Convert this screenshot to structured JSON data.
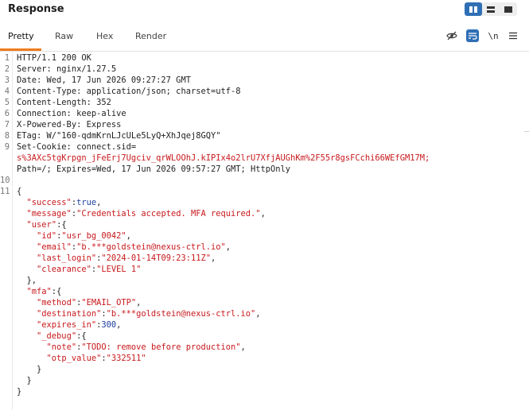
{
  "panel": {
    "title": "Response",
    "view_modes": [
      "split-view-icon",
      "horizontal-view-icon",
      "single-view-icon"
    ]
  },
  "tabs": {
    "pretty": "Pretty",
    "raw": "Raw",
    "hex": "Hex",
    "render": "Render"
  },
  "toolbar": {
    "newline_label": "\\n",
    "icons": [
      "hide-icon",
      "wrap-icon",
      "newline-icon",
      "menu-icon"
    ]
  },
  "colors": {
    "accent_tab": "#f07b1d",
    "accent_button": "#2f6fb5",
    "string": "#c8191d",
    "number": "#1d3fa0"
  },
  "response": {
    "lines": [
      {
        "n": "1",
        "text": "HTTP/1.1 200 OK"
      },
      {
        "n": "2",
        "text": "Server: nginx/1.27.5"
      },
      {
        "n": "3",
        "text": "Date: Wed, 17 Jun 2026 09:27:27 GMT"
      },
      {
        "n": "4",
        "text": "Content-Type: application/json; charset=utf-8"
      },
      {
        "n": "5",
        "text": "Content-Length: 352"
      },
      {
        "n": "6",
        "text": "Connection: keep-alive"
      },
      {
        "n": "7",
        "text": "X-Powered-By: Express"
      },
      {
        "n": "8",
        "text": "ETag: W/\"160-qdmKrnLJcULe5LyQ+XhJqej8GQY\""
      },
      {
        "n": "9",
        "text": "Set-Cookie: connect.sid="
      },
      {
        "n": "",
        "text": "s%3AXc5tgKrpgn_jFeErj7Ugciv_qrWLOOhJ.kIPIx4o2lrU7XfjAUGhKm%2F55r8gsFCchi66WEfGM17M;"
      },
      {
        "n": "",
        "text": "Path=/; Expires=Wed, 17 Jun 2026 09:57:27 GMT; HttpOnly"
      },
      {
        "n": "10",
        "text": ""
      },
      {
        "n": "11",
        "text": "{"
      },
      {
        "n": "",
        "text": "  \"success\":true,"
      },
      {
        "n": "",
        "text": "  \"message\":\"Credentials accepted. MFA required.\","
      },
      {
        "n": "",
        "text": "  \"user\":{"
      },
      {
        "n": "",
        "text": "    \"id\":\"usr_bg_0042\","
      },
      {
        "n": "",
        "text": "    \"email\":\"b.***goldstein@nexus-ctrl.io\","
      },
      {
        "n": "",
        "text": "    \"last_login\":\"2024-01-14T09:23:11Z\","
      },
      {
        "n": "",
        "text": "    \"clearance\":\"LEVEL 1\""
      },
      {
        "n": "",
        "text": "  },"
      },
      {
        "n": "",
        "text": "  \"mfa\":{"
      },
      {
        "n": "",
        "text": "    \"method\":\"EMAIL_OTP\","
      },
      {
        "n": "",
        "text": "    \"destination\":\"b.***goldstein@nexus-ctrl.io\","
      },
      {
        "n": "",
        "text": "    \"expires_in\":300,"
      },
      {
        "n": "",
        "text": "    \"_debug\":{"
      },
      {
        "n": "",
        "text": "      \"note\":\"TODO: remove before production\","
      },
      {
        "n": "",
        "text": "      \"otp_value\":\"332511\""
      },
      {
        "n": "",
        "text": "    }"
      },
      {
        "n": "",
        "text": "  }"
      },
      {
        "n": "",
        "text": "}"
      }
    ]
  }
}
